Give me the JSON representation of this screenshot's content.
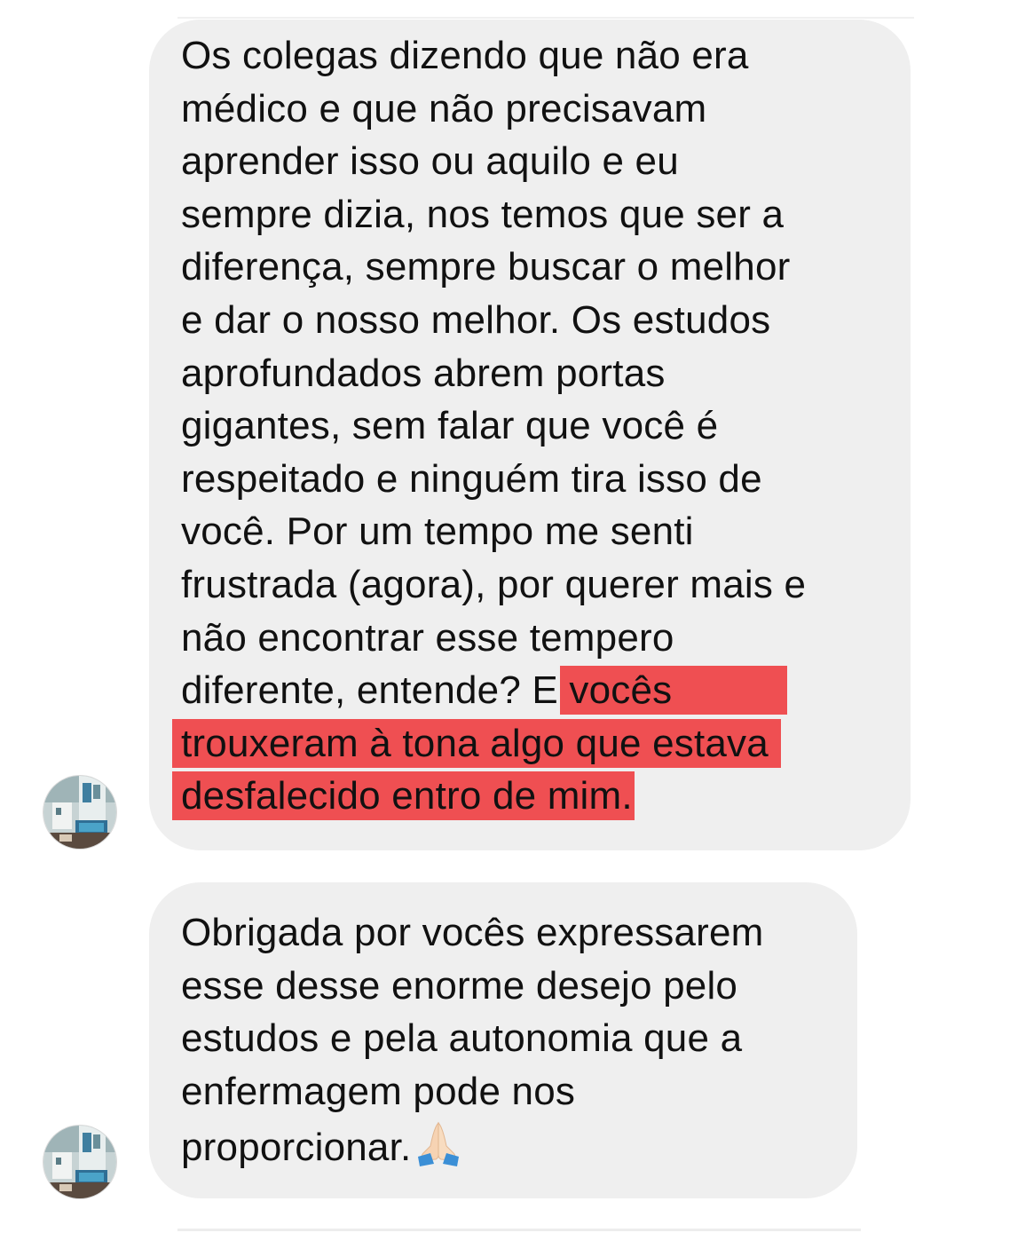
{
  "conversation": {
    "messages": [
      {
        "sender": "other",
        "lines_before_highlight": "Os colegas dizendo que não era\nmédico e que não precisavam\naprender isso ou aquilo e eu\nsempre dizia, nos temos que ser a\ndiferença, sempre buscar o melhor\ne dar o nosso melhor. Os estudos\naprofundados abrem portas\ngigantes, sem falar que você é\nrespeitado e ninguém tira isso de\nvocê. Por um tempo me senti\nfrustrada (agora), por querer mais e\nnão encontrar esse tempero\ndiferente, entende? E",
        "highlight_line_1": "vocês",
        "highlight_line_2": "trouxeram à tona algo que estava",
        "highlight_line_3": "desfalecido entro de mim."
      },
      {
        "sender": "other",
        "text": "Obrigada por vocês expressarem\nesse desse enorme desejo pelo\nestudos e pela autonomia que a\nenfermagem pode nos\nproporcionar.",
        "emoji": "folded-hands-icon"
      }
    ]
  },
  "colors": {
    "bubble_background": "#efefef",
    "highlight": "#ef4f52",
    "text": "#111111"
  }
}
